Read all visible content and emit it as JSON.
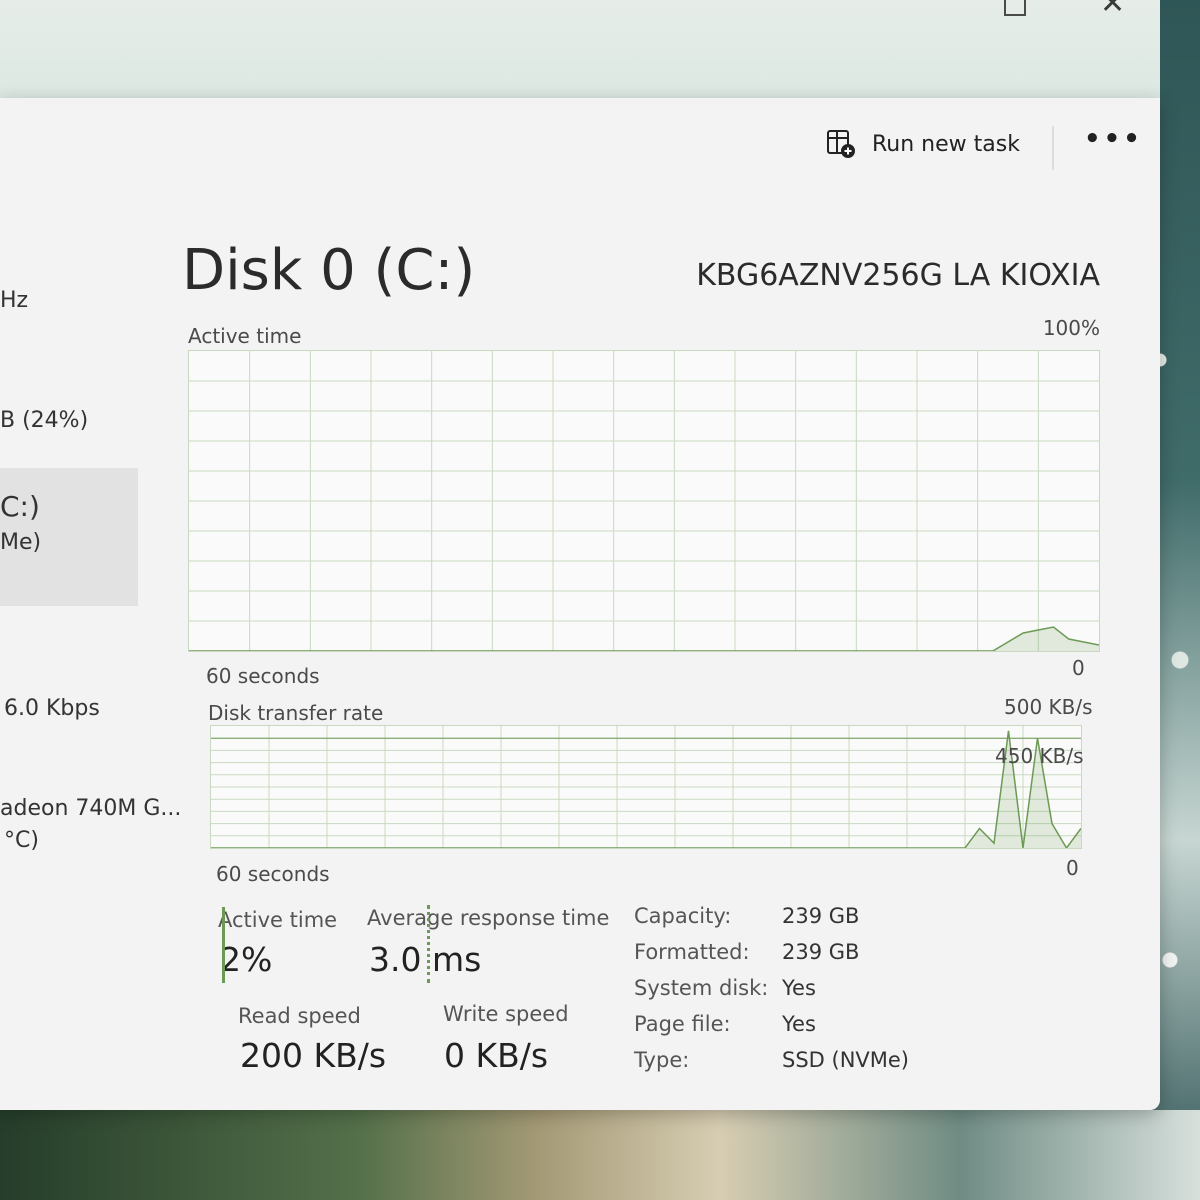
{
  "window": {
    "controls": {
      "minimize": "—",
      "close": "✕"
    }
  },
  "toolbar": {
    "run_new_task": "Run new task",
    "more": "•••"
  },
  "sidebar": {
    "items": [
      {
        "text": "Hz"
      },
      {
        "text": "B (24%)"
      },
      {
        "text": "C:)"
      },
      {
        "text": "Me)"
      },
      {
        "text": "6.0 Kbps"
      },
      {
        "text": "adeon 740M G..."
      },
      {
        "text": "°C)"
      }
    ]
  },
  "disk": {
    "title": "Disk 0 (C:)",
    "model": "KBG6AZNV256G LA KIOXIA"
  },
  "active_graph": {
    "label": "Active time",
    "max": "100%",
    "time_span": "60 seconds",
    "min": "0",
    "values_percent": [
      0,
      0,
      0,
      0,
      0,
      0,
      0,
      0,
      0,
      0,
      0,
      0,
      0,
      0,
      0,
      0,
      0,
      0,
      0,
      0,
      0,
      0,
      0,
      0,
      0,
      0,
      0,
      0,
      0,
      0,
      0,
      0,
      0,
      0,
      0,
      0,
      0,
      0,
      0,
      0,
      0,
      0,
      0,
      0,
      0,
      0,
      0,
      0,
      0,
      0,
      0,
      0,
      0,
      0,
      3,
      6,
      7,
      8,
      4,
      3,
      2
    ]
  },
  "transfer_graph": {
    "label": "Disk transfer rate",
    "max": "500 KB/s",
    "marker": "450 KB/s",
    "time_span": "60 seconds",
    "min": "0",
    "values_kbps": [
      0,
      0,
      0,
      0,
      0,
      0,
      0,
      0,
      0,
      0,
      0,
      0,
      0,
      0,
      0,
      0,
      0,
      0,
      0,
      0,
      0,
      0,
      0,
      0,
      0,
      0,
      0,
      0,
      0,
      0,
      0,
      0,
      0,
      0,
      0,
      0,
      0,
      0,
      0,
      0,
      0,
      0,
      0,
      0,
      0,
      0,
      0,
      0,
      0,
      0,
      0,
      0,
      0,
      80,
      20,
      480,
      0,
      450,
      100,
      0,
      80
    ]
  },
  "stats": {
    "active_time_label": "Active time",
    "active_time_value": "2%",
    "avg_response_label": "Average response time",
    "avg_response_value": "3.0 ms",
    "read_label": "Read speed",
    "read_value": "200 KB/s",
    "write_label": "Write speed",
    "write_value": "0 KB/s"
  },
  "properties": {
    "capacity_label": "Capacity:",
    "capacity_value": "239 GB",
    "formatted_label": "Formatted:",
    "formatted_value": "239 GB",
    "system_label": "System disk:",
    "system_value": "Yes",
    "page_label": "Page file:",
    "page_value": "Yes",
    "type_label": "Type:",
    "type_value": "SSD (NVMe)"
  },
  "colors": {
    "accent": "#6c9a54",
    "grid": "#c8d9c0"
  }
}
